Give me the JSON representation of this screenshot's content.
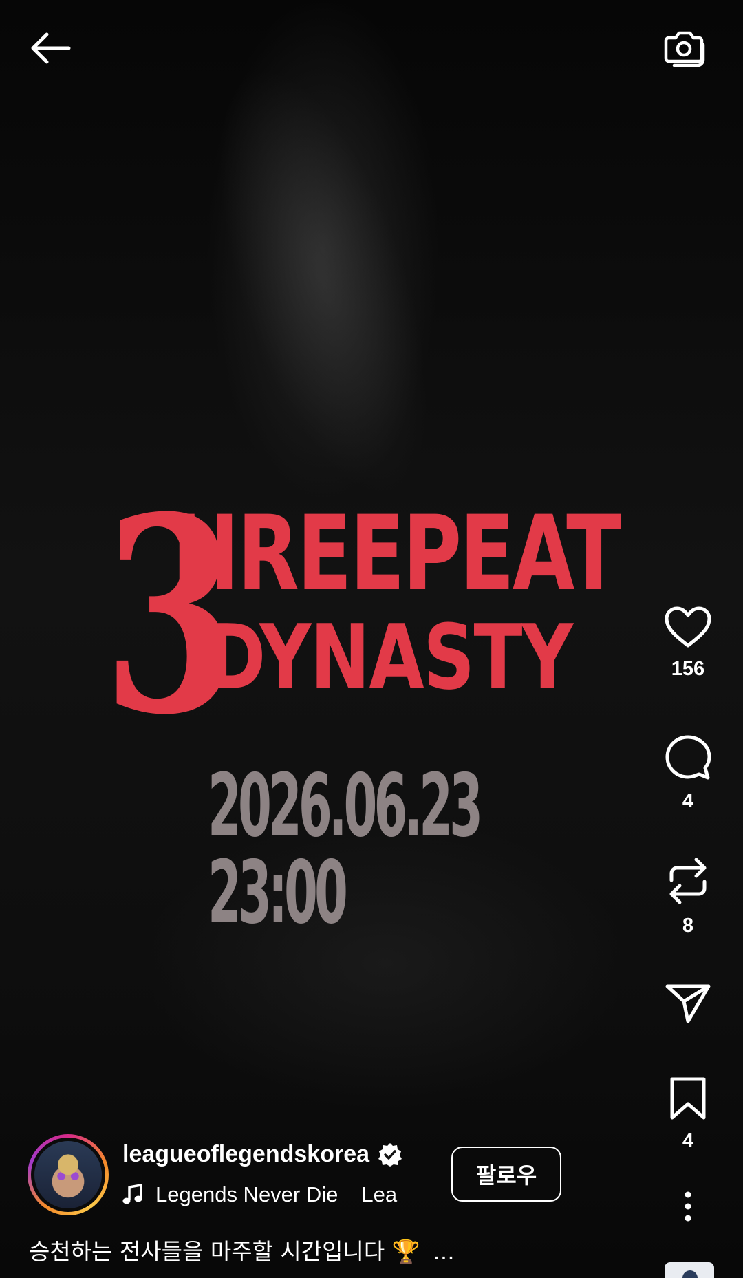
{
  "header": {
    "back_icon": "arrow-left-icon",
    "camera_icon": "camera-icon"
  },
  "video": {
    "logo_line1": "HREEPEAT",
    "logo_line2": "DYNASTY",
    "logo_numeral": "3",
    "date_text": "2026.06.23 23:00",
    "accent_color": "#e23a48",
    "date_color": "#8d8384"
  },
  "rail": {
    "like_icon": "heart-icon",
    "like_count": "156",
    "comment_icon": "comment-bubble-icon",
    "comment_count": "4",
    "repost_icon": "repost-icon",
    "repost_count": "8",
    "share_icon": "send-icon",
    "save_icon": "bookmark-icon",
    "save_count": "4",
    "more_icon": "more-vertical-icon"
  },
  "author": {
    "username": "leagueoflegendskorea",
    "verified_icon": "verified-badge-icon",
    "music_icon": "music-note-icon",
    "music_title": "Legends Never Die",
    "music_title_scroll": "Lea",
    "follow_label": "팔로우"
  },
  "caption": {
    "text": "승천하는 전사들을 마주할 시간입니다 🏆",
    "more_label": "..."
  }
}
